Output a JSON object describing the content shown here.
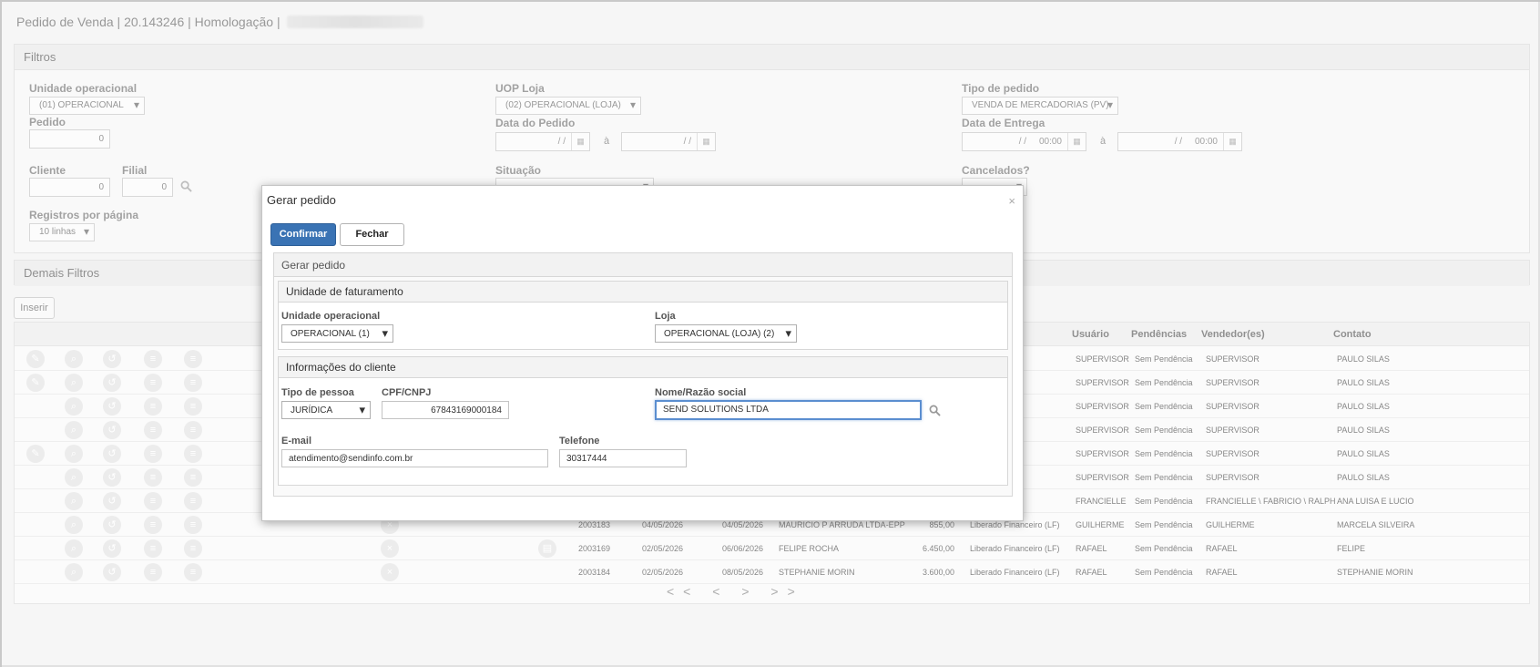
{
  "app": {
    "title_prefix": "Pedido de Venda | 20.143246 | Homologação |"
  },
  "filters": {
    "panel_title": "Filtros",
    "unidade_operacional": {
      "label": "Unidade operacional",
      "value": "(01) OPERACIONAL"
    },
    "uop_loja": {
      "label": "UOP Loja",
      "value": "(02) OPERACIONAL (LOJA)"
    },
    "tipo_pedido": {
      "label": "Tipo de pedido",
      "value": "VENDA DE MERCADORIAS (PV)"
    },
    "pedido": {
      "label": "Pedido",
      "value": "0"
    },
    "data_pedido": {
      "label": "Data do Pedido",
      "from": "/ /",
      "to": "/ /",
      "sep": "à"
    },
    "data_entrega": {
      "label": "Data de Entrega",
      "from": "/ /     00:00",
      "to": "/ /     00:00",
      "sep": "à"
    },
    "cliente": {
      "label": "Cliente",
      "value": "0"
    },
    "filial": {
      "label": "Filial",
      "value": "0"
    },
    "situacao": {
      "label": "Situação"
    },
    "cancelados": {
      "label": "Cancelados?"
    },
    "registros": {
      "label": "Registros por página",
      "value": "10 linhas"
    }
  },
  "demais_filtros": {
    "title": "Demais Filtros"
  },
  "inserir_label": "Inserir",
  "grid": {
    "headers": {
      "usuario": "Usuário",
      "pendencias": "Pendências",
      "vendedor": "Vendedor(es)",
      "contato": "Contato"
    },
    "rows": [
      {
        "pedido": "",
        "data": "",
        "entrega": "",
        "cliente": "",
        "valor": "",
        "situacao": "",
        "usuario": "SUPERVISOR",
        "pendencias": "Sem Pendência",
        "vendedor": "SUPERVISOR",
        "contato": "PAULO SILAS"
      },
      {
        "pedido": "",
        "data": "",
        "entrega": "",
        "cliente": "",
        "valor": "",
        "situacao": "",
        "usuario": "SUPERVISOR",
        "pendencias": "Sem Pendência",
        "vendedor": "SUPERVISOR",
        "contato": "PAULO SILAS"
      },
      {
        "pedido": "",
        "data": "",
        "entrega": "",
        "cliente": "",
        "valor": "",
        "situacao": "iro (LF)",
        "usuario": "SUPERVISOR",
        "pendencias": "Sem Pendência",
        "vendedor": "SUPERVISOR",
        "contato": "PAULO SILAS"
      },
      {
        "pedido": "",
        "data": "",
        "entrega": "",
        "cliente": "",
        "valor": "",
        "situacao": "iro (LF)",
        "usuario": "SUPERVISOR",
        "pendencias": "Sem Pendência",
        "vendedor": "SUPERVISOR",
        "contato": "PAULO SILAS"
      },
      {
        "pedido": "",
        "data": "",
        "entrega": "",
        "cliente": "",
        "valor": "",
        "situacao": "",
        "usuario": "SUPERVISOR",
        "pendencias": "Sem Pendência",
        "vendedor": "SUPERVISOR",
        "contato": "PAULO SILAS"
      },
      {
        "pedido": "",
        "data": "",
        "entrega": "",
        "cliente": "",
        "valor": "",
        "situacao": "iro (LF)",
        "usuario": "SUPERVISOR",
        "pendencias": "Sem Pendência",
        "vendedor": "SUPERVISOR",
        "contato": "PAULO SILAS"
      },
      {
        "pedido": "",
        "data": "",
        "entrega": "",
        "cliente": "",
        "valor": "",
        "situacao": "iro (LF)",
        "usuario": "FRANCIELLE",
        "pendencias": "Sem Pendência",
        "vendedor": "FRANCIELLE \\ FABRICIO \\ RALPH",
        "contato": "ANA LUISA E LUCIO"
      },
      {
        "pedido": "2003183",
        "data": "04/05/2026",
        "entrega": "04/05/2026",
        "cliente": "MAURICIO P ARRUDA LTDA-EPP",
        "valor": "855,00",
        "situacao": "Liberado Financeiro (LF)",
        "usuario": "GUILHERME",
        "pendencias": "Sem Pendência",
        "vendedor": "GUILHERME",
        "contato": "MARCELA SILVEIRA"
      },
      {
        "pedido": "2003169",
        "data": "02/05/2026",
        "entrega": "06/06/2026",
        "cliente": "FELIPE ROCHA",
        "valor": "6.450,00",
        "situacao": "Liberado Financeiro (LF)",
        "usuario": "RAFAEL",
        "pendencias": "Sem Pendência",
        "vendedor": "RAFAEL",
        "contato": "FELIPE"
      },
      {
        "pedido": "2003184",
        "data": "02/05/2026",
        "entrega": "08/05/2026",
        "cliente": "STEPHANIE MORIN",
        "valor": "3.600,00",
        "situacao": "Liberado Financeiro (LF)",
        "usuario": "RAFAEL",
        "pendencias": "Sem Pendência",
        "vendedor": "RAFAEL",
        "contato": "STEPHANIE MORIN"
      }
    ]
  },
  "pager": {
    "first": "<<",
    "prev": "<",
    "next": ">",
    "last": ">>"
  },
  "modal": {
    "title": "Gerar pedido",
    "close": "×",
    "confirm_label": "Confirmar",
    "close_label": "Fechar",
    "section_title": "Gerar pedido",
    "faturamento": {
      "title": "Unidade de faturamento",
      "unidade_label": "Unidade operacional",
      "unidade_value": "OPERACIONAL (1)",
      "loja_label": "Loja",
      "loja_value": "OPERACIONAL (LOJA) (2)"
    },
    "cliente": {
      "title": "Informações do cliente",
      "tipo_label": "Tipo de pessoa",
      "tipo_value": "JURÍDICA",
      "cpf_label": "CPF/CNPJ",
      "cpf_value": "67843169000184",
      "nome_label": "Nome/Razão social",
      "nome_value": "SEND SOLUTIONS LTDA",
      "email_label": "E-mail",
      "email_value": "atendimento@sendinfo.com.br",
      "telefone_label": "Telefone",
      "telefone_value": "30317444"
    }
  }
}
